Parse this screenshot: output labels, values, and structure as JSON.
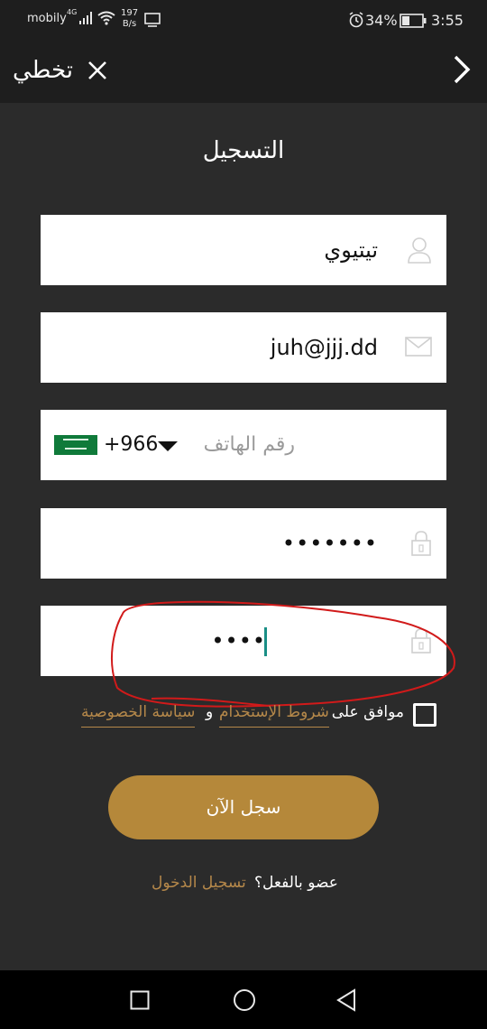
{
  "status_bar": {
    "carrier": "mobily",
    "network": "4G",
    "speed_value": "197",
    "speed_unit": "B/s",
    "battery": "34%",
    "time": "3:55"
  },
  "top_bar": {
    "skip_label": "تخطي"
  },
  "title": "التسجيل",
  "form": {
    "name_value": "تيتيوي",
    "email_value": "juh@jjj.dd",
    "phone_placeholder": "رقم الهاتف",
    "dial_code": "+966",
    "password_value": "•••••••",
    "confirm_value": "••••"
  },
  "agreement": {
    "agree_text": "موافق على",
    "terms_link": "شروط الإستخدام",
    "and_text": "و",
    "privacy_link": "سياسة الخصوصية"
  },
  "register_button": "سجل الآن",
  "login": {
    "member_text": "عضو بالفعل؟",
    "login_link": "تسجيل الدخول"
  },
  "colors": {
    "background": "#2b2b2b",
    "accent": "#b5883a",
    "annotation": "#d11a1a"
  },
  "icons": {
    "close": "close-icon",
    "forward": "chevron-right-icon",
    "user": "user-icon",
    "mail": "mail-icon",
    "lock": "lock-icon"
  }
}
